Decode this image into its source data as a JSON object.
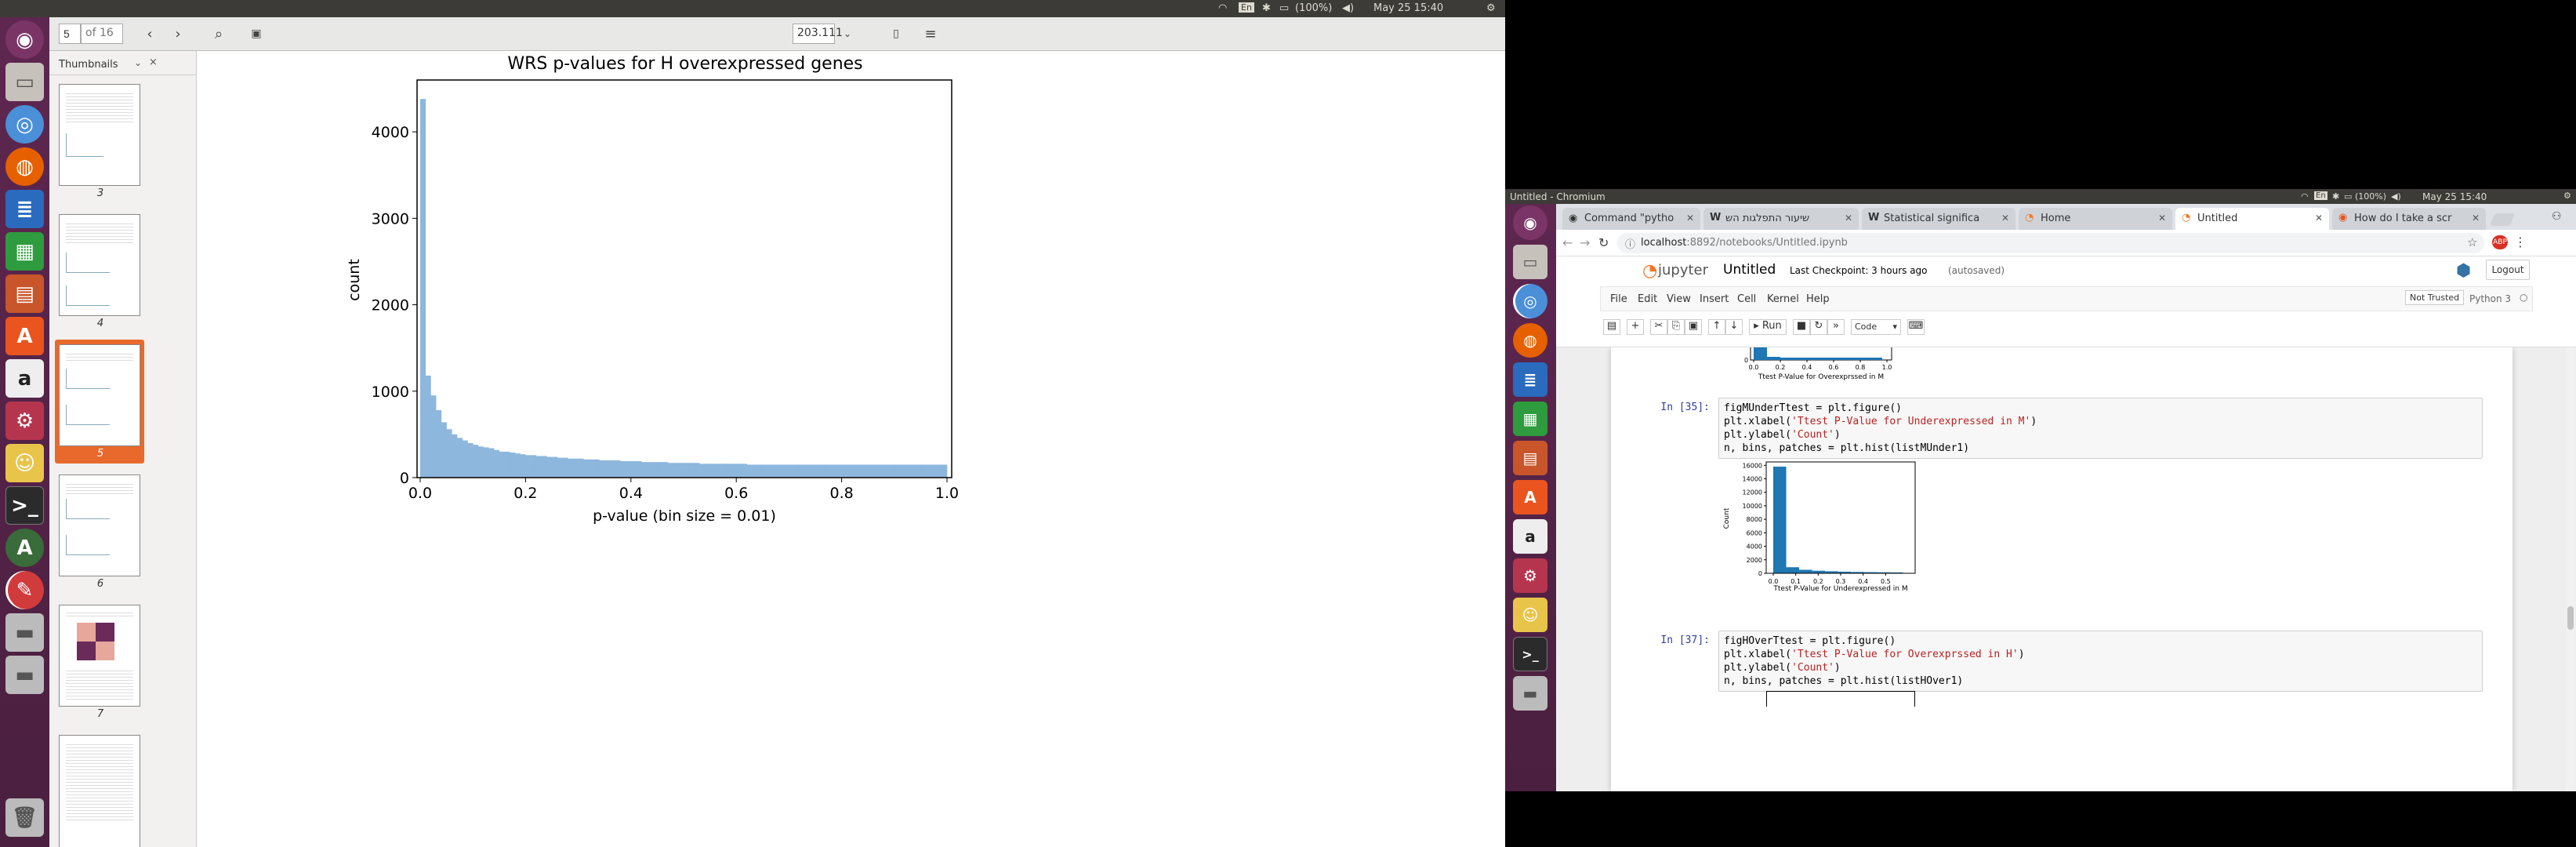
{
  "left_topbar": {
    "lang": "En",
    "battery": "(100%)",
    "clock": "May 25 15:40"
  },
  "evince": {
    "page_value": "5",
    "page_count": "of 16",
    "zoom": "203.111"
  },
  "sidebar": {
    "title": "Thumbnails",
    "close": "×",
    "pages": [
      "3",
      "4",
      "5",
      "6",
      "7"
    ]
  },
  "doc_chart": {
    "title": "WRS p-values for H overexpressed genes",
    "xlabel": "p-value (bin size = 0.01)",
    "ylabel": "count",
    "xticks": [
      "0.0",
      "0.2",
      "0.4",
      "0.6",
      "0.8",
      "1.0"
    ],
    "yticks": [
      "0",
      "1000",
      "2000",
      "3000",
      "4000"
    ]
  },
  "chart_data": [
    {
      "type": "bar",
      "title": "WRS p-values for H overexpressed genes",
      "xlabel": "p-value (bin size = 0.01)",
      "ylabel": "count",
      "xlim": [
        0,
        1
      ],
      "ylim": [
        0,
        4600
      ],
      "bin_width": 0.01,
      "color": "#8db7dd",
      "values": [
        4380,
        1180,
        950,
        780,
        640,
        560,
        500,
        460,
        430,
        400,
        380,
        360,
        350,
        340,
        320,
        300,
        300,
        290,
        280,
        270,
        260,
        260,
        250,
        250,
        240,
        240,
        230,
        230,
        220,
        220,
        220,
        210,
        210,
        210,
        200,
        200,
        200,
        200,
        190,
        190,
        190,
        190,
        180,
        180,
        180,
        180,
        180,
        170,
        170,
        170,
        170,
        170,
        170,
        160,
        160,
        160,
        160,
        160,
        160,
        160,
        160,
        160,
        150,
        150,
        150,
        150,
        150,
        150,
        150,
        150,
        150,
        150,
        150,
        150,
        150,
        150,
        150,
        150,
        150,
        150,
        150,
        150,
        150,
        150,
        150,
        150,
        150,
        150,
        150,
        150,
        150,
        150,
        150,
        150,
        150,
        150,
        150,
        150,
        150,
        150
      ]
    },
    {
      "type": "bar",
      "xlabel": "Ttest P-Value for Underexpressed in M",
      "ylabel": "Count",
      "ylim": [
        0,
        16500
      ],
      "xlim": [
        0,
        0.6
      ],
      "bin_width": 0.0577,
      "color": "#1f77b4",
      "values": [
        15800,
        900,
        520,
        380,
        300,
        240,
        200,
        170,
        150,
        130
      ]
    },
    {
      "type": "bar",
      "xlabel": "Ttest P-Value for Overexprsssed in M",
      "xlim": [
        0,
        1.05
      ],
      "ylim": [
        0,
        1
      ],
      "bin_width": 0.105,
      "color": "#1f77b4",
      "values": [
        1,
        0.15,
        0.1,
        0.08,
        0.07,
        0.06,
        0.06,
        0.05,
        0.05,
        0.05
      ]
    }
  ],
  "right_topbar": {
    "title": "Untitled - Chromium",
    "lang": "En",
    "battery": "(100%)",
    "clock": "May 25 15:40"
  },
  "tabs": [
    "Command \"pytho",
    "שיעור התפלגות הש",
    "Statistical significa",
    "Home",
    "Untitled",
    "How do I take a scr"
  ],
  "url": {
    "host": "localhost",
    "rest": ":8892/notebooks/Untitled.ipynb"
  },
  "jupyter": {
    "logo": "jupyter",
    "name": "Untitled",
    "checkpoint": "Last Checkpoint: 3 hours ago",
    "autosave": "(autosaved)",
    "logout": "Logout",
    "menus": [
      "File",
      "Edit",
      "View",
      "Insert",
      "Cell",
      "Kernel",
      "Help"
    ],
    "trusted": "Not Trusted",
    "kernel": "Python 3",
    "run": "Run",
    "celltype": "Code"
  },
  "cells": [
    {
      "prompt": "In [35]:",
      "lines": [
        "figMUnderTtest = plt.figure()",
        "plt.xlabel(|'Ttest P-Value for Underexpressed in M'|)",
        "plt.ylabel(|'Count'|)",
        "n, bins, patches = plt.hist(listMUnder1)"
      ]
    },
    {
      "prompt": "In [37]:",
      "lines": [
        "figHOverTtest = plt.figure()",
        "plt.xlabel(|'Ttest P-Value for Overexprssed in H'|)",
        "plt.ylabel(|'Count'|)",
        "n, bins, patches = plt.hist(listHOver1)"
      ]
    }
  ],
  "plot_top": {
    "xticks": [
      "0.0",
      "0.2",
      "0.4",
      "0.6",
      "0.8",
      "1.0"
    ],
    "xlabel": "Ttest P-Value for Overexprssed in M"
  },
  "plot_mid": {
    "xticks": [
      "0.0",
      "0.1",
      "0.2",
      "0.3",
      "0.4",
      "0.5"
    ],
    "yticks": [
      "0",
      "2000",
      "4000",
      "6000",
      "8000",
      "10000",
      "12000",
      "14000",
      "16000"
    ],
    "xlabel": "Ttest P-Value for Underexpressed in M",
    "ylabel": "Count"
  }
}
